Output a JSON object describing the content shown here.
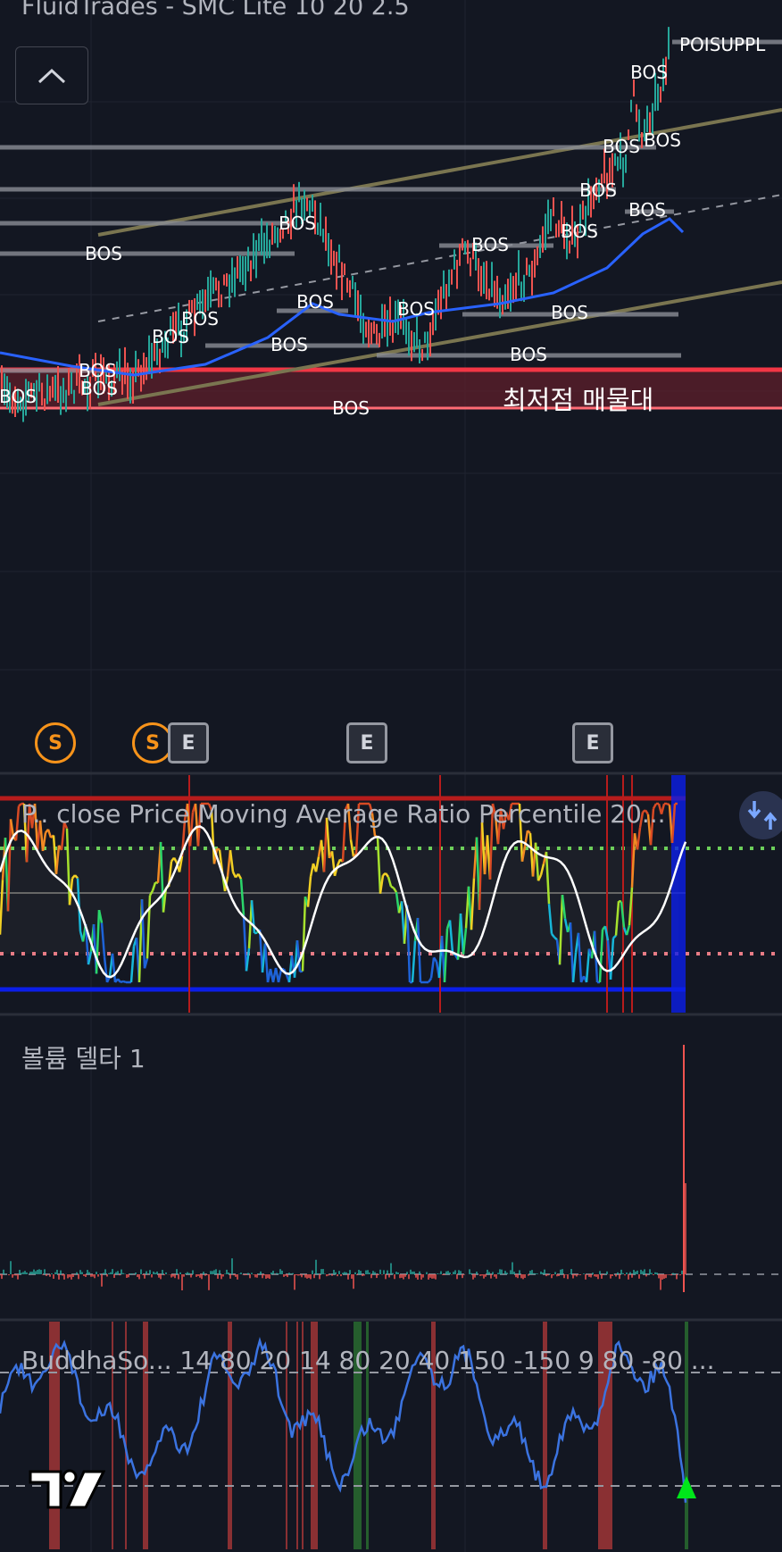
{
  "header": {
    "title": "FluidTrades - SMC Lite 10 20 2.5",
    "collapse_icon": "chevron-up-icon"
  },
  "main_chart": {
    "poi_label": "POISUPPL",
    "zone_label": "최저점 매물대",
    "bos_label": "BOS",
    "colors": {
      "up": "#26a69a",
      "down": "#ef5350",
      "ma": "#2962ff",
      "zone": "#f23645",
      "channel": "#7a7550"
    }
  },
  "events": {
    "s_label": "S",
    "e_label": "E"
  },
  "percentile_panel": {
    "label": "P..  close Price Moving Average Ratio Percentile 20...",
    "swap_icon": "swap-panes-icon"
  },
  "volume_panel": {
    "label": "볼륨 델타 1"
  },
  "buddha_panel": {
    "label": "BuddhaSo...   14 80 20 14 80 20 40 150 -150 9 80 -80 ..."
  },
  "logo": "TV"
}
